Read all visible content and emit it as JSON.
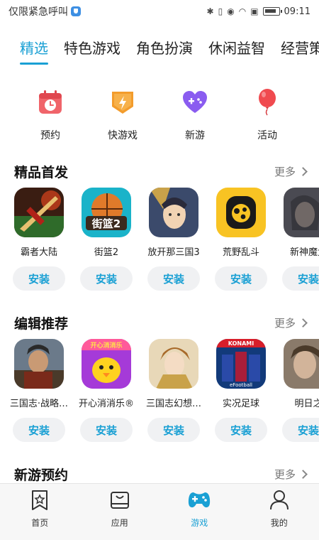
{
  "status_bar": {
    "carrier_text": "仅限紧急呼叫",
    "time": "09:11"
  },
  "tabs": [
    {
      "label": "精选",
      "active": true
    },
    {
      "label": "特色游戏",
      "active": false
    },
    {
      "label": "角色扮演",
      "active": false
    },
    {
      "label": "休闲益智",
      "active": false
    },
    {
      "label": "经营策",
      "active": false
    }
  ],
  "quick_entries": [
    {
      "label": "预约",
      "icon": "calendar-clock-icon"
    },
    {
      "label": "快游戏",
      "icon": "lightning-badge-icon"
    },
    {
      "label": "新游",
      "icon": "heart-gamepad-icon"
    },
    {
      "label": "活动",
      "icon": "balloon-icon"
    }
  ],
  "sections": [
    {
      "title": "精品首发",
      "more": "更多",
      "apps": [
        {
          "name": "霸者大陆",
          "install": "安装"
        },
        {
          "name": "街篮2",
          "install": "安装"
        },
        {
          "name": "放开那三国3",
          "install": "安装"
        },
        {
          "name": "荒野乱斗",
          "install": "安装"
        },
        {
          "name": "新神魔大",
          "install": "安装"
        }
      ]
    },
    {
      "title": "编辑推荐",
      "more": "更多",
      "apps": [
        {
          "name": "三国志·战略…",
          "install": "安装"
        },
        {
          "name": "开心消消乐®",
          "install": "安装"
        },
        {
          "name": "三国志幻想…",
          "install": "安装"
        },
        {
          "name": "实况足球",
          "install": "安装"
        },
        {
          "name": "明日之",
          "install": "安装"
        }
      ]
    },
    {
      "title": "新游预约",
      "more": "更多"
    }
  ],
  "app_icon_texts": {
    "jielan": "街篮2",
    "konami": "KONAMI",
    "efootball": "eFootball",
    "xiaoxiao": "开心消消乐"
  },
  "bottom_nav": [
    {
      "label": "首页",
      "icon": "home-star-icon",
      "active": false
    },
    {
      "label": "应用",
      "icon": "app-bag-icon",
      "active": false
    },
    {
      "label": "游戏",
      "icon": "gamepad-icon",
      "active": true
    },
    {
      "label": "我的",
      "icon": "person-icon",
      "active": false
    }
  ],
  "colors": {
    "accent": "#1aa0d4",
    "install_bg": "#f0f1f3"
  }
}
